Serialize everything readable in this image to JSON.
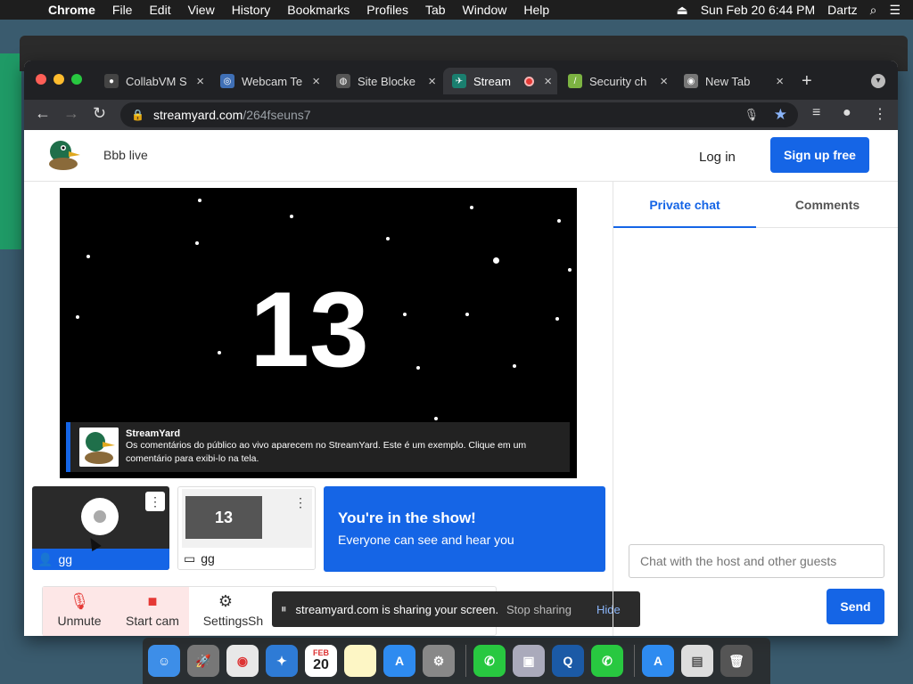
{
  "menubar": {
    "app": "Chrome",
    "items": [
      "File",
      "Edit",
      "View",
      "History",
      "Bookmarks",
      "Profiles",
      "Tab",
      "Window",
      "Help"
    ],
    "clock": "Sun Feb 20  6:44 PM",
    "user": "Dartz"
  },
  "tabs": [
    {
      "title": "CollabVM S",
      "favicon_color": "#444"
    },
    {
      "title": "Webcam Te",
      "favicon_color": "#3f6fb5"
    },
    {
      "title": "Site Blocke",
      "favicon_color": "#555"
    },
    {
      "title": "Stream",
      "favicon_color": "#1a7f6f"
    },
    {
      "title": "Security ch",
      "favicon_color": "#7cb342"
    },
    {
      "title": "New Tab",
      "favicon_color": "#777"
    }
  ],
  "address": {
    "host": "streamyard.com",
    "path": "/264fseuns7"
  },
  "header": {
    "brand": "Bbb live",
    "login": "Log in",
    "signup": "Sign up free"
  },
  "stage": {
    "countdown": "13",
    "banner_name": "StreamYard",
    "banner_text": "Os comentários do público ao vivo aparecem no StreamYard. Este é um exemplo. Clique em um comentário para exibi-lo na tela."
  },
  "tiles": {
    "cam_label": "gg",
    "screen_label": "gg",
    "screen_count": "13",
    "show_title": "You're in the show!",
    "show_sub": "Everyone can see and hear you"
  },
  "controls": {
    "unmute": "Unmute",
    "start_cam": "Start cam",
    "settings": "Settings",
    "more": "Sh"
  },
  "share": {
    "text": "streamyard.com is sharing your screen.",
    "stop": "Stop sharing",
    "hide": "Hide"
  },
  "sidebar": {
    "tab_private": "Private chat",
    "tab_comments": "Comments",
    "chat_placeholder": "Chat with the host and other guests",
    "send": "Send"
  },
  "dock": {
    "calendar_day": "20",
    "calendar_month": "FEB"
  },
  "colors": {
    "accent": "#1565e6",
    "danger": "#e53935"
  }
}
